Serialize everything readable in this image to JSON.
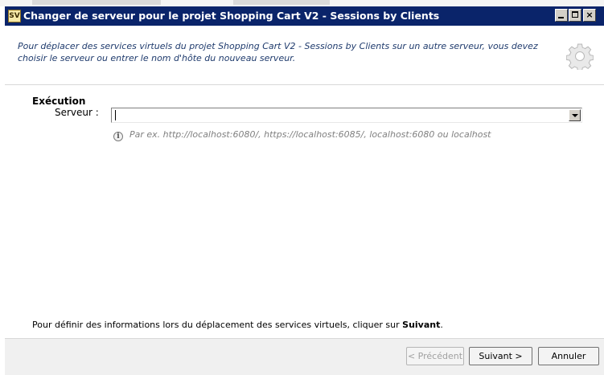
{
  "window": {
    "title": "Changer de serveur pour le projet Shopping Cart V2 - Sessions by Clients",
    "app_icon_label": "SV",
    "controls": {
      "minimize_icon": "minimize-icon",
      "maximize_icon": "maximize-icon",
      "close_label": "×"
    }
  },
  "header": {
    "description": "Pour déplacer des services virtuels du projet Shopping Cart V2 - Sessions by Clients sur un autre serveur, vous devez choisir le serveur ou entrer le nom d'hôte du nouveau serveur.",
    "icon": "gear-icon"
  },
  "form": {
    "section_title": "Exécution",
    "server_label": "Serveur :",
    "server_value": "",
    "hint_icon_glyph": "i",
    "hint": "Par ex. http://localhost:6080/, https://localhost:6085/, localhost:6080 ou localhost"
  },
  "footer": {
    "text_prefix": "Pour définir des informations lors du déplacement des services virtuels, cliquer sur ",
    "text_bold": "Suivant",
    "text_suffix": "."
  },
  "buttons": {
    "previous": "< Précédent",
    "next": "Suivant >",
    "cancel": "Annuler"
  },
  "colors": {
    "titlebar": "#0a246a",
    "header_text": "#1f3b6d",
    "hint_text": "#808080"
  }
}
